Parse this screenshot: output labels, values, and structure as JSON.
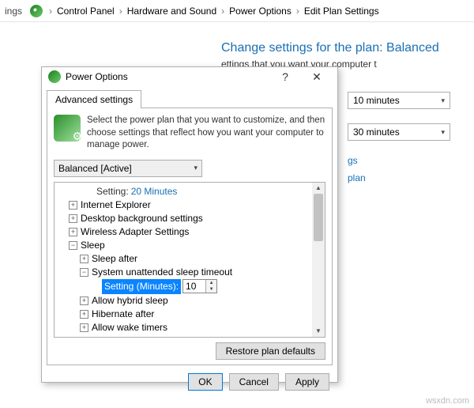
{
  "breadcrumb": {
    "partial": "ings",
    "items": [
      "Control Panel",
      "Hardware and Sound",
      "Power Options",
      "Edit Plan Settings"
    ]
  },
  "main": {
    "title": "Change settings for the plan: Balanced",
    "subtitle": "ettings that you want your computer t",
    "dropdown1": "10 minutes",
    "dropdown2": "30 minutes",
    "link1": "gs",
    "link2": "plan"
  },
  "dialog": {
    "title": "Power Options",
    "tab": "Advanced settings",
    "header": "Select the power plan that you want to customize, and then choose settings that reflect how you want your computer to manage power.",
    "plan": "Balanced [Active]",
    "tree": {
      "setting_label": "Setting:",
      "setting_value": "20 Minutes",
      "ie": "Internet Explorer",
      "dbs": "Desktop background settings",
      "was": "Wireless Adapter Settings",
      "sleep": "Sleep",
      "sleep_after": "Sleep after",
      "sut": "System unattended sleep timeout",
      "setting_min": "Setting (Minutes):",
      "setting_min_value": "10",
      "ahs": "Allow hybrid sleep",
      "ha": "Hibernate after",
      "awt": "Allow wake timers"
    },
    "restore": "Restore plan defaults",
    "ok": "OK",
    "cancel": "Cancel",
    "apply": "Apply"
  },
  "watermark": "wsxdn.com"
}
